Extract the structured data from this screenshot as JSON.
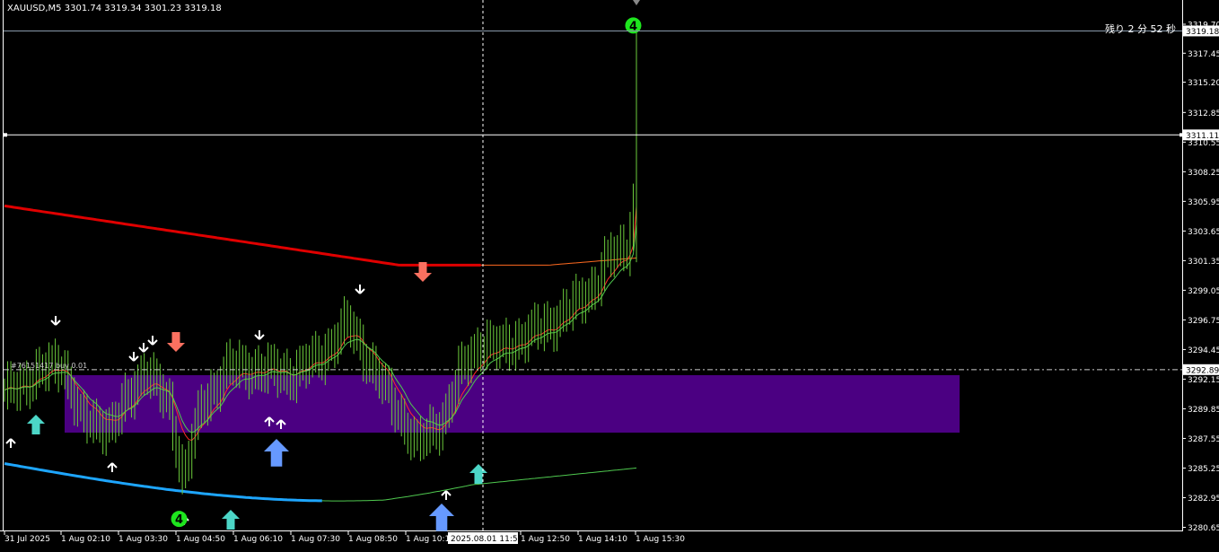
{
  "header": {
    "symbol": "XAUUSD,M5",
    "ohlc": "3301.74 3319.34 3301.23 3319.18"
  },
  "countdown": "残り 2 分 52 秒",
  "order_label": "#76151417 buy 0.01",
  "cursor_time_label": "2025.08.01 11:55",
  "colors": {
    "background": "#000000",
    "candle": "#6ccc3b",
    "ema_fast": "#ff2a2a",
    "ema_slow_red": "#e00000",
    "ema_slow_green": "#4fc94f",
    "ema_slow_blue": "#1ea6ff",
    "supply_zone": "#4b0082",
    "arrow_white": "#ffffff",
    "arrow_salmon": "#fa7060",
    "arrow_teal": "#4cd6c7",
    "arrow_blue": "#6699ff",
    "signal_badge": "#1ee61e"
  },
  "chart_data": {
    "type": "candlestick",
    "y_ticks": [
      "3319.70",
      "3317.45",
      "3315.20",
      "3312.85",
      "3310.55",
      "3308.25",
      "3305.95",
      "3303.65",
      "3301.35",
      "3299.05",
      "3296.75",
      "3294.45",
      "3292.15",
      "3289.85",
      "3287.55",
      "3285.25",
      "3282.95",
      "3280.65"
    ],
    "ylim": [
      3280.3,
      3320.6
    ],
    "price_labels": {
      "bid": "3319.18",
      "hline": "3311.11",
      "order": "3292.89"
    },
    "x_labels": [
      "31 Jul 2025",
      "1 Aug 02:10",
      "1 Aug 03:30",
      "1 Aug 04:50",
      "1 Aug 06:10",
      "1 Aug 07:30",
      "1 Aug 08:50",
      "1 Aug 10:10",
      "1 Aug 12:50",
      "1 Aug 14:10",
      "1 Aug 15:30"
    ],
    "badges": [
      {
        "text": "4",
        "bar": 198,
        "price": 3319.6
      },
      {
        "text": "4",
        "bar": 55,
        "price": 3281.3
      }
    ]
  }
}
